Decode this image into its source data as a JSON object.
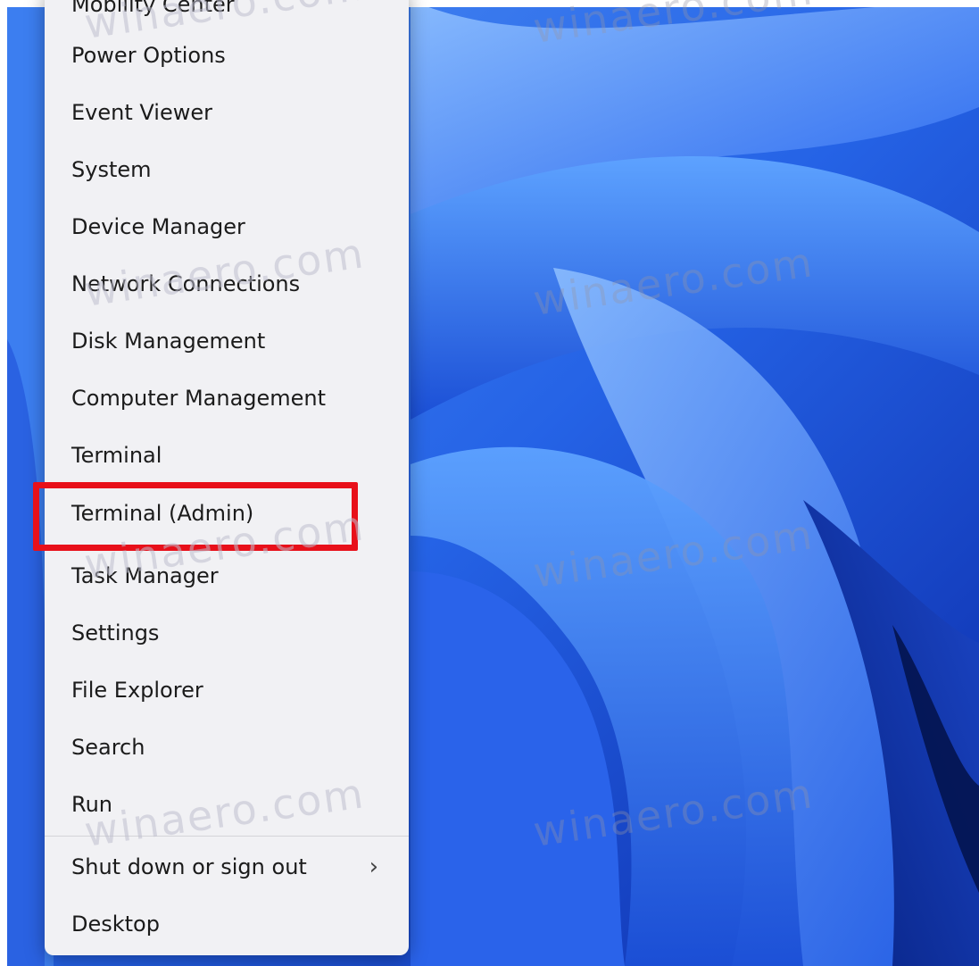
{
  "context_menu": {
    "partial_top_item": "Mobility Center",
    "items": [
      {
        "label": "Power Options"
      },
      {
        "label": "Event Viewer"
      },
      {
        "label": "System"
      },
      {
        "label": "Device Manager"
      },
      {
        "label": "Network Connections"
      },
      {
        "label": "Disk Management"
      },
      {
        "label": "Computer Management"
      },
      {
        "label": "Terminal"
      },
      {
        "label": "Terminal (Admin)",
        "highlighted": true
      },
      {
        "label": "Task Manager"
      },
      {
        "label": "Settings"
      },
      {
        "label": "File Explorer"
      },
      {
        "label": "Search"
      },
      {
        "label": "Run"
      },
      {
        "label": "Shut down or sign out",
        "icon": "chevron-right-icon"
      },
      {
        "label": "Desktop"
      }
    ],
    "submenu_glyph": "›"
  },
  "watermark": {
    "text": "winaero.com"
  },
  "colors": {
    "wallpaper_blue": "#2f6fe8",
    "menu_background": "#f1f1f4",
    "highlight_red": "#e8101a"
  }
}
